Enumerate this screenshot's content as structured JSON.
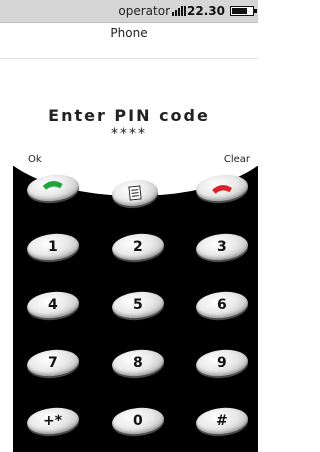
{
  "status": {
    "operator": "operator",
    "time": "22.30",
    "signal_icon": "signal-bars-icon",
    "battery_icon": "battery-icon",
    "battery_level": 0.75
  },
  "title": "Phone",
  "pin": {
    "prompt": "Enter PIN code",
    "masked_value": "****"
  },
  "softkeys": {
    "left": "Ok",
    "right": "Clear"
  },
  "colors": {
    "call_green": "#1fa33b",
    "end_red": "#d9222a"
  },
  "keypad": {
    "keys": [
      "1",
      "2",
      "3",
      "4",
      "5",
      "6",
      "7",
      "8",
      "9",
      "+*",
      "0",
      "#"
    ]
  }
}
